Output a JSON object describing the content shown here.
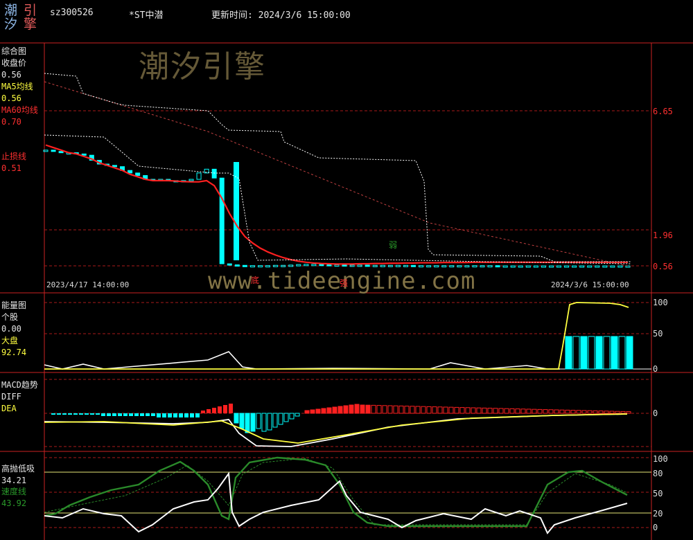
{
  "header": {
    "logo_chars": [
      "潮",
      "引",
      "汐",
      "擎"
    ],
    "code": "sz300526",
    "name": "*ST中潜",
    "update_time": "更新时间: 2024/3/6 15:00:00"
  },
  "watermark": {
    "brand": "潮汐引擎",
    "url": "www.tideengine.com"
  },
  "colors": {
    "cyan": "#00ffff",
    "red": "#ff2020",
    "yellow": "#ffff40",
    "white": "#ffffff",
    "green": "#2a8a2a",
    "grid_red": "#aa1a1a",
    "axis_red": "#cc2222"
  },
  "panels": {
    "main": {
      "labels": [
        {
          "text": "综合图",
          "color": "#e6e6e6"
        },
        {
          "text": "收盘价",
          "color": "#e6e6e6"
        },
        {
          "text": "0.56",
          "color": "#e6e6e6"
        },
        {
          "text": "MA5均线",
          "color": "#ffff40"
        },
        {
          "text": "0.56",
          "color": "#ffff40"
        },
        {
          "text": "MA60均线",
          "color": "#ff3030"
        },
        {
          "text": "0.70",
          "color": "#ff3030"
        },
        {
          "text": "",
          "color": "#000"
        },
        {
          "text": "止损线",
          "color": "#ff3030"
        },
        {
          "text": "0.51",
          "color": "#ff3030"
        }
      ],
      "axis": [
        "6.65",
        "1.96",
        "0.56"
      ],
      "start_date": "2023/4/17 14:00:00",
      "end_date": "2024/3/6 15:00:00",
      "signals": {
        "bottom": "底",
        "strong": "强",
        "weak": "弱"
      }
    },
    "energy": {
      "labels": [
        {
          "text": "能量图",
          "color": "#e6e6e6"
        },
        {
          "text": "个股",
          "color": "#e6e6e6"
        },
        {
          "text": "0.00",
          "color": "#e6e6e6"
        },
        {
          "text": "大盘",
          "color": "#ffff40"
        },
        {
          "text": "92.74",
          "color": "#ffff40"
        }
      ],
      "axis": [
        "100",
        "50",
        "0"
      ]
    },
    "macd": {
      "labels": [
        {
          "text": "MACD趋势",
          "color": "#e6e6e6"
        },
        {
          "text": "DIFF",
          "color": "#e6e6e6"
        },
        {
          "text": "DEA",
          "color": "#ffff40"
        }
      ],
      "axis": [
        "0"
      ]
    },
    "kdj": {
      "labels": [
        {
          "text": "高抛低吸",
          "color": "#e6e6e6"
        },
        {
          "text": "34.21",
          "color": "#e6e6e6"
        },
        {
          "text": "速度线",
          "color": "#2a9a2a"
        },
        {
          "text": "43.92",
          "color": "#2a9a2a"
        }
      ],
      "axis": [
        "100",
        "80",
        "50",
        "20",
        "0"
      ]
    }
  },
  "chart_data": [
    {
      "type": "line",
      "title": "综合图",
      "x": [
        "2023/4/17 14:00:00",
        "",
        "",
        "",
        "",
        "",
        "",
        "",
        "",
        "",
        "",
        "",
        "",
        "",
        "",
        "",
        "",
        "",
        "",
        "",
        "",
        "",
        "",
        "",
        "",
        "",
        "",
        "",
        "",
        "",
        "",
        "",
        "",
        "",
        "",
        "",
        "",
        "",
        "",
        "",
        "",
        "",
        "",
        "",
        "",
        "",
        "",
        "",
        "",
        "",
        "",
        "",
        "",
        "",
        "",
        "",
        "",
        "",
        "",
        "",
        "",
        "",
        "",
        "",
        "",
        "",
        "",
        "",
        "",
        "",
        "",
        "",
        "",
        "",
        "",
        "",
        "",
        "2024/3/6 15:00:00"
      ],
      "y_ticks": [
        6.65,
        1.96,
        0.56
      ],
      "series": [
        {
          "name": "收盘价",
          "values": [
            5.1,
            5.05,
            5.0,
            5.0,
            4.95,
            4.9,
            4.7,
            4.55,
            4.5,
            4.45,
            4.3,
            4.2,
            4.1,
            3.95,
            3.9,
            3.95,
            3.9,
            3.85,
            3.9,
            3.95,
            4.2,
            4.35,
            4.0,
            0.64,
            0.6,
            0.58,
            0.57,
            0.57,
            0.57,
            0.57,
            0.58,
            0.58,
            0.59,
            0.61,
            0.62,
            0.62,
            0.61,
            0.6,
            0.6,
            0.59,
            0.59,
            0.59,
            0.58,
            0.58,
            0.58,
            0.58,
            0.58,
            0.58,
            0.57,
            0.57,
            0.57,
            0.57,
            0.57,
            0.57,
            0.57,
            0.57,
            0.57,
            0.57,
            0.57,
            0.56,
            0.56,
            0.56,
            0.56,
            0.56,
            0.56,
            0.56,
            0.56,
            0.56,
            0.56,
            0.56,
            0.56,
            0.56,
            0.56,
            0.56,
            0.56,
            0.56,
            0.56
          ]
        },
        {
          "name": "MA60均线",
          "values": [
            5.3,
            5.2,
            5.1,
            5.0,
            4.95,
            4.85,
            4.75,
            4.6,
            4.5,
            4.4,
            4.3,
            4.15,
            4.05,
            3.95,
            3.9,
            3.9,
            3.9,
            3.88,
            3.86,
            3.85,
            3.85,
            3.9,
            3.7,
            3.2,
            2.6,
            2.1,
            1.7,
            1.45,
            1.25,
            1.1,
            0.98,
            0.88,
            0.8,
            0.74,
            0.7,
            0.67,
            0.65,
            0.64,
            0.63,
            0.63,
            0.63,
            0.64,
            0.64,
            0.65,
            0.65,
            0.66,
            0.66,
            0.67,
            0.67,
            0.68,
            0.68,
            0.68,
            0.69,
            0.69,
            0.69,
            0.69,
            0.7,
            0.7,
            0.7,
            0.7,
            0.7,
            0.7,
            0.7,
            0.7,
            0.7,
            0.7,
            0.7,
            0.7,
            0.7,
            0.7,
            0.7,
            0.7,
            0.7,
            0.7,
            0.7,
            0.7,
            0.7
          ]
        },
        {
          "name": "止损线",
          "values": [
            0.51
          ]
        }
      ]
    },
    {
      "type": "line",
      "title": "能量图",
      "y_ticks": [
        100,
        50,
        0
      ],
      "series": [
        {
          "name": "个股",
          "values": [
            0.0
          ]
        },
        {
          "name": "大盘",
          "values": [
            92.74
          ]
        }
      ]
    },
    {
      "type": "bar",
      "title": "MACD趋势",
      "y_ticks": [
        0
      ],
      "series": [
        {
          "name": "DIFF"
        },
        {
          "name": "DEA"
        }
      ]
    },
    {
      "type": "line",
      "title": "高抛低吸",
      "y_ticks": [
        100,
        80,
        50,
        20,
        0
      ],
      "series": [
        {
          "name": "高抛低吸",
          "values": [
            34.21
          ]
        },
        {
          "name": "速度线",
          "values": [
            43.92
          ]
        }
      ]
    }
  ]
}
